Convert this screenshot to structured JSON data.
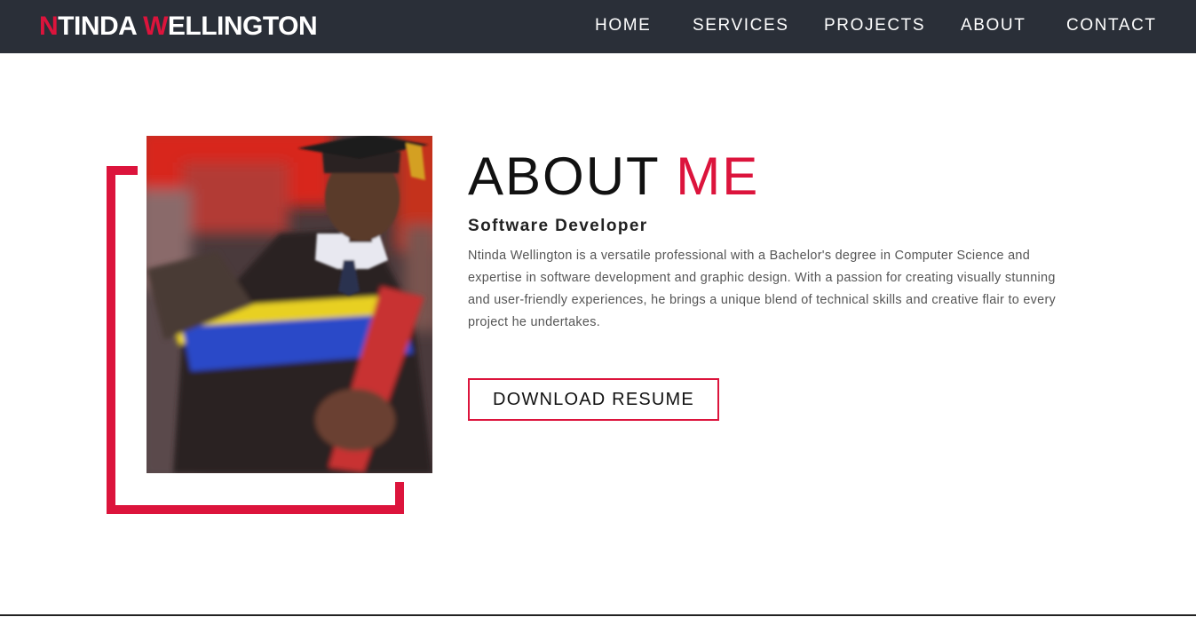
{
  "header": {
    "logo": {
      "first_initial": "N",
      "first_rest": "TINDA ",
      "last_initial": "W",
      "last_rest": "ELLINGTON"
    },
    "nav": [
      {
        "label": "HOME"
      },
      {
        "label": "SERVICES"
      },
      {
        "label": "PROJECTS"
      },
      {
        "label": "ABOUT"
      },
      {
        "label": "CONTACT"
      }
    ]
  },
  "about": {
    "title_main": "ABOUT",
    "title_accent": "ME",
    "subtitle": "Software Developer",
    "bio": "Ntinda Wellington is a versatile professional with a Bachelor's degree in Computer Science and expertise in software development and graphic design. With a passion for creating visually stunning and user-friendly experiences, he brings a unique blend of technical skills and creative flair to every project he undertakes.",
    "resume_button": "DOWNLOAD RESUME"
  },
  "theme": {
    "accent": "#dc143c",
    "navbar_bg": "#2a2f38",
    "text_dark": "#111111",
    "text_muted": "#555555"
  }
}
